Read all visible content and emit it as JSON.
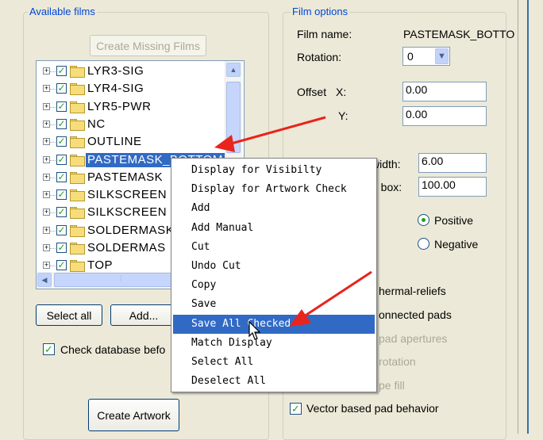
{
  "available_films": {
    "title": "Available films",
    "create_missing_label": "Create Missing Films",
    "tree_items": [
      {
        "label": "LYR3-SIG",
        "checked": true
      },
      {
        "label": "LYR4-SIG",
        "checked": true
      },
      {
        "label": "LYR5-PWR",
        "checked": true
      },
      {
        "label": "NC",
        "checked": true
      },
      {
        "label": "OUTLINE",
        "checked": true
      },
      {
        "label": "PASTEMASK_BOTTOM",
        "checked": true,
        "selected": true
      },
      {
        "label": "PASTEMASK",
        "checked": true
      },
      {
        "label": "SILKSCREEN",
        "checked": true
      },
      {
        "label": "SILKSCREEN",
        "checked": true
      },
      {
        "label": "SOLDERMASK",
        "checked": true
      },
      {
        "label": "SOLDERMAS",
        "checked": true
      },
      {
        "label": "TOP",
        "checked": true
      }
    ],
    "select_all_label": "Select all",
    "add_label": "Add...",
    "check_database_label": "Check database befo",
    "check_database_checked": true,
    "create_artwork_label": "Create Artwork"
  },
  "film_options": {
    "title": "Film options",
    "film_name_label": "Film name:",
    "film_name_value": "PASTEMASK_BOTTO",
    "rotation_label": "Rotation:",
    "rotation_value": "0",
    "offset_label": "Offset",
    "offset_x_label": "X:",
    "offset_x_value": "0.00",
    "offset_y_label": "Y:",
    "offset_y_value": "0.00",
    "width_label": "width:",
    "width_value": "6.00",
    "box_label": "g box:",
    "box_value": "100.00",
    "positive_label": "Positive",
    "negative_label": "Negative",
    "polarity": "Positive",
    "thermal_label": "hermal-reliefs",
    "connected_label": "onnected pads",
    "apertures_label": "pad apertures",
    "rotation_opt_label": "rotation",
    "fill_label": "pe fill",
    "vector_label": "Vector based pad behavior",
    "vector_checked": true
  },
  "context_menu": {
    "items": [
      "Display for Visibilty",
      "Display for Artwork Check",
      "Add",
      "Add Manual",
      "Cut",
      "Undo Cut",
      "Copy",
      "Save",
      "Save All Checked",
      "Match Display",
      "Select All",
      "Deselect All"
    ],
    "highlighted": "Save All Checked"
  },
  "icons": {
    "tree_check": "✓",
    "expand": "+",
    "scroll_up": "▲",
    "scroll_down": "▼",
    "scroll_left": "◀",
    "scroll_right": "▶",
    "combo_arrow": "▼",
    "grip": "⁞"
  },
  "colors": {
    "group_title": "#0046d5",
    "selection": "#316ac5",
    "annotation_arrow": "#e8241c",
    "check_mark": "#21a121"
  }
}
